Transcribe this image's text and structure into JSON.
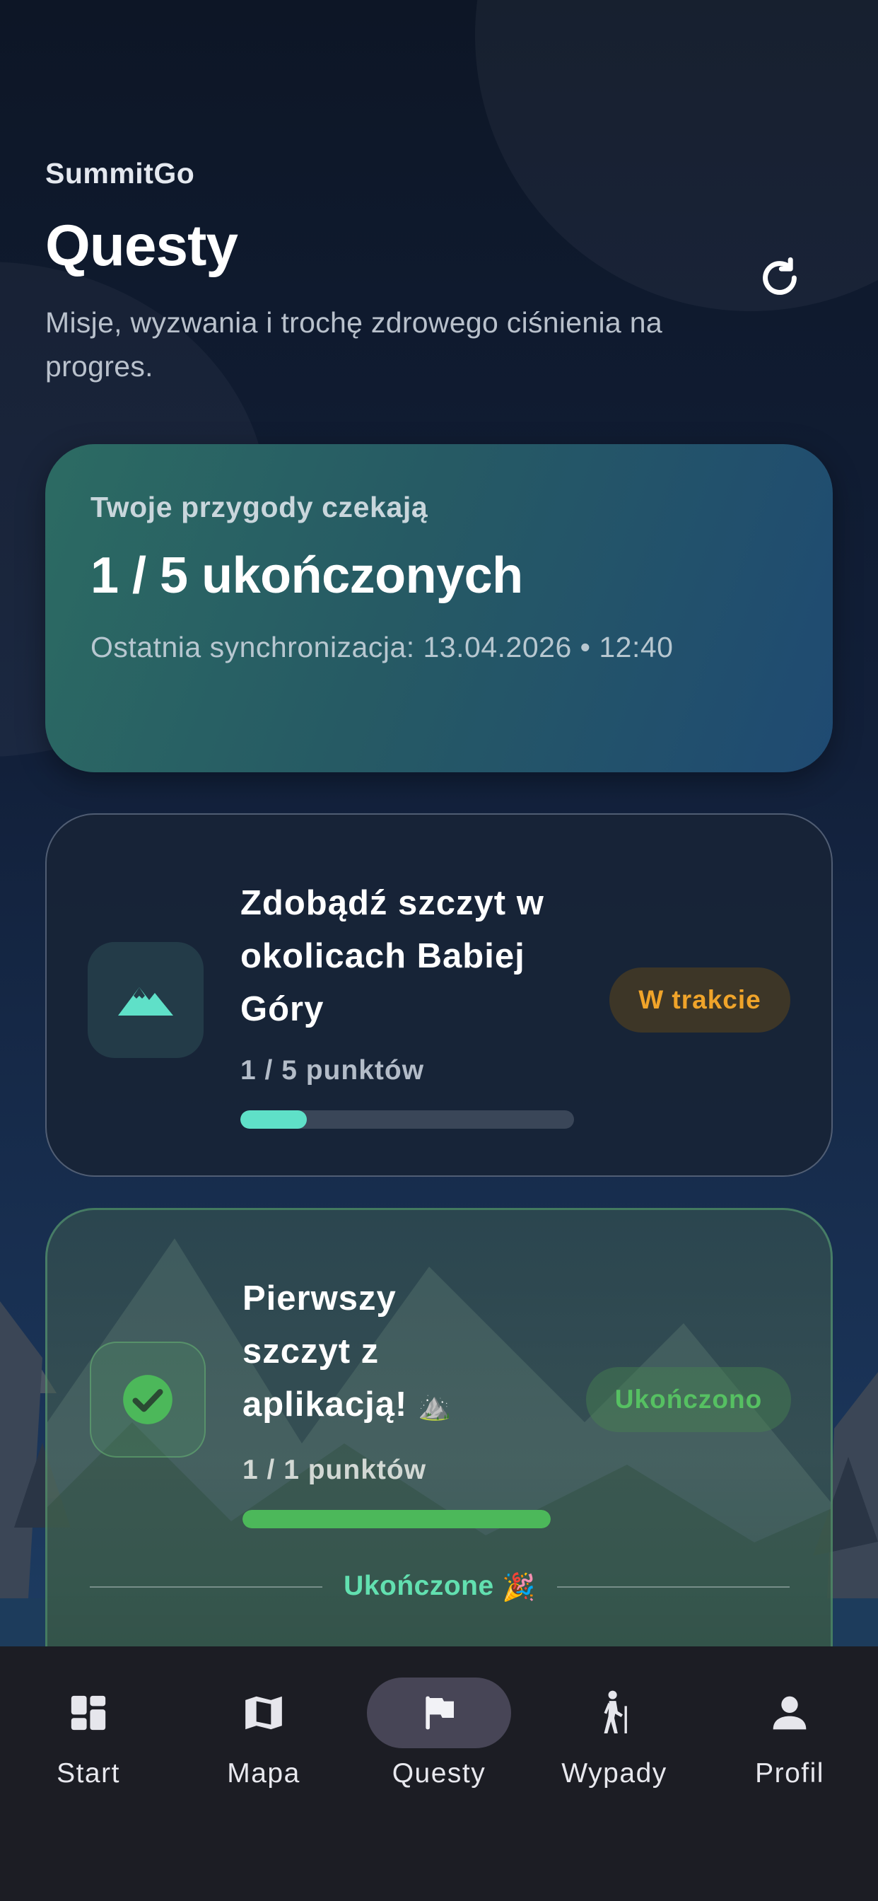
{
  "header": {
    "app_name": "SummitGo",
    "title": "Questy",
    "subtitle": "Misje, wyzwania i trochę zdrowego ciśnienia na progres."
  },
  "summary": {
    "label": "Twoje przygody czekają",
    "count": "1 / 5 ukończonych",
    "sync": "Ostatnia synchronizacja: 13.04.2026 • 12:40"
  },
  "quests": [
    {
      "title": "Zdobądź szczyt w okolicach Babiej Góry",
      "icon": "mountain-icon",
      "progress_text": "1 / 5 punktów",
      "progress": 0.2,
      "status": "W trakcie",
      "accent": "#5fe0c8",
      "status_color": "#f0a42a"
    },
    {
      "title": "Pierwszy szczyt z aplikacją!",
      "title_emoji": "⛰️",
      "icon": "check-circle-icon",
      "progress_text": "1 / 1 punktów",
      "progress": 1.0,
      "status": "Ukończono",
      "accent": "#4cb85a",
      "status_color": "#56c062"
    }
  ],
  "completed_section": {
    "label": "Ukończone",
    "emoji": "🎉"
  },
  "tabs": [
    {
      "label": "Start",
      "icon": "dashboard-icon",
      "active": false
    },
    {
      "label": "Mapa",
      "icon": "map-icon",
      "active": false
    },
    {
      "label": "Questy",
      "icon": "flag-icon",
      "active": true
    },
    {
      "label": "Wypady",
      "icon": "hiker-icon",
      "active": false
    },
    {
      "label": "Profil",
      "icon": "person-icon",
      "active": false
    }
  ]
}
